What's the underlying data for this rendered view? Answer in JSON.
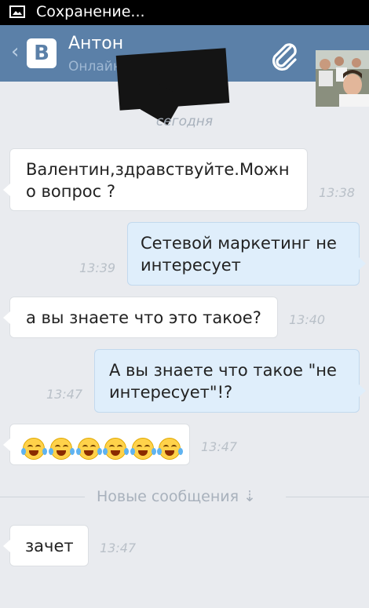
{
  "statusbar": {
    "text": "Сохранение..."
  },
  "header": {
    "back_glyph": "‹",
    "logo_text": "В",
    "contact_name": "Антон",
    "contact_status": "Онлайн",
    "attach_icon": "paperclip-icon"
  },
  "chat": {
    "date_label": "сегодня",
    "messages": [
      {
        "direction": "in",
        "lines": [
          "Валентин,здравствуйте.Можн",
          "о вопрос ?"
        ],
        "time": "13:38"
      },
      {
        "direction": "out",
        "lines": [
          "Сетевой маркетинг не",
          "интересует"
        ],
        "time": "13:39"
      },
      {
        "direction": "in",
        "lines": [
          "а вы знаете что это такое?"
        ],
        "time": "13:40"
      },
      {
        "direction": "out",
        "lines": [
          "А вы знаете что такое \"не",
          "интересует\"!?"
        ],
        "time": "13:47"
      },
      {
        "direction": "in",
        "emoji_count": 6,
        "emoji": "face-with-tears-of-joy",
        "time": "13:47"
      },
      {
        "direction": "in",
        "lines": [
          "зачет"
        ],
        "time": "13:47"
      }
    ],
    "new_messages_label": "Новые сообщения ⇣"
  },
  "colors": {
    "header": "#5b80a8",
    "background": "#e9ebef",
    "outgoing_bubble": "#dfeefb",
    "incoming_bubble": "#ffffff"
  }
}
